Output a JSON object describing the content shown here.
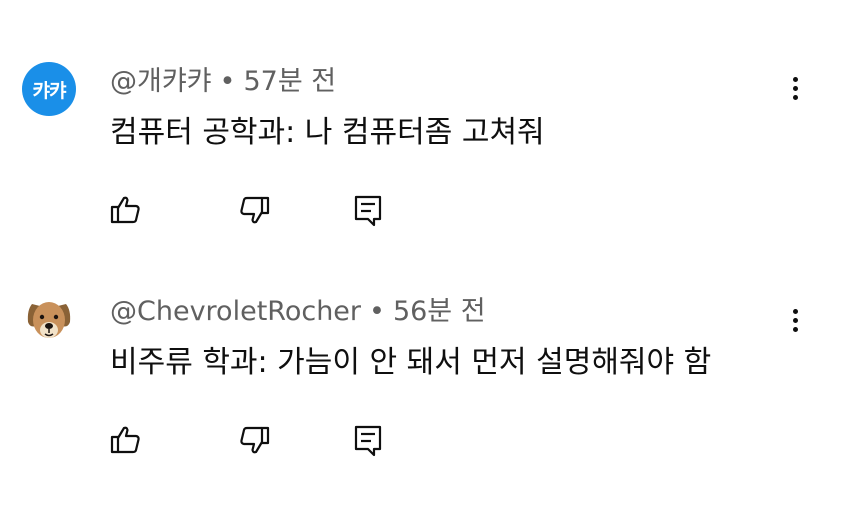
{
  "comments": [
    {
      "avatar_text": "캬캬",
      "author": "@개캬캬",
      "separator": "•",
      "time": "57분 전",
      "text": "컴퓨터 공학과: 나 컴퓨터좀 고쳐줘",
      "avatar_color": "#1a8fe8"
    },
    {
      "author": "@ChevroletRocher",
      "separator": "•",
      "time": "56분 전",
      "text": "비주류 학과: 가늠이 안 돼서 먼저 설명해줘야 함"
    }
  ],
  "icons": {
    "like": "thumbs-up-icon",
    "dislike": "thumbs-down-icon",
    "reply": "reply-icon",
    "more": "more-vertical-icon"
  }
}
